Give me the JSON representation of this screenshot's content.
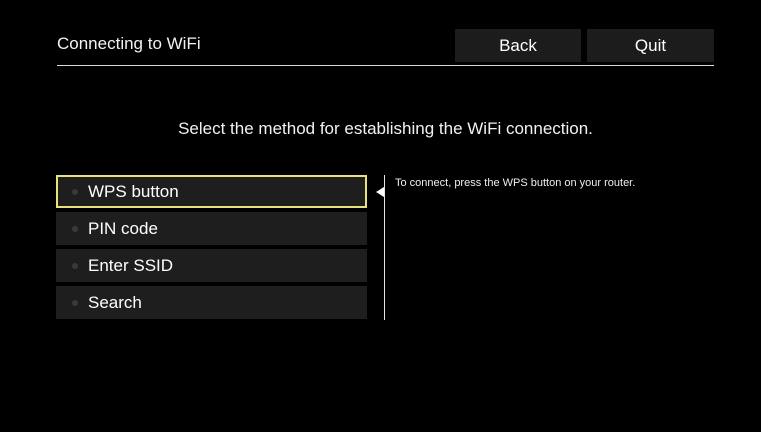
{
  "header": {
    "title": "Connecting to WiFi",
    "back_label": "Back",
    "quit_label": "Quit"
  },
  "prompt": "Select the method for establishing the WiFi connection.",
  "menu": {
    "items": [
      {
        "label": "WPS button",
        "selected": true
      },
      {
        "label": "PIN code",
        "selected": false
      },
      {
        "label": "Enter SSID",
        "selected": false
      },
      {
        "label": "Search",
        "selected": false
      }
    ]
  },
  "hint": "To connect, press the WPS button on your router.",
  "colors": {
    "background": "#000000",
    "selection_border": "#e8e27a",
    "button_bg": "#1c1c1c"
  }
}
